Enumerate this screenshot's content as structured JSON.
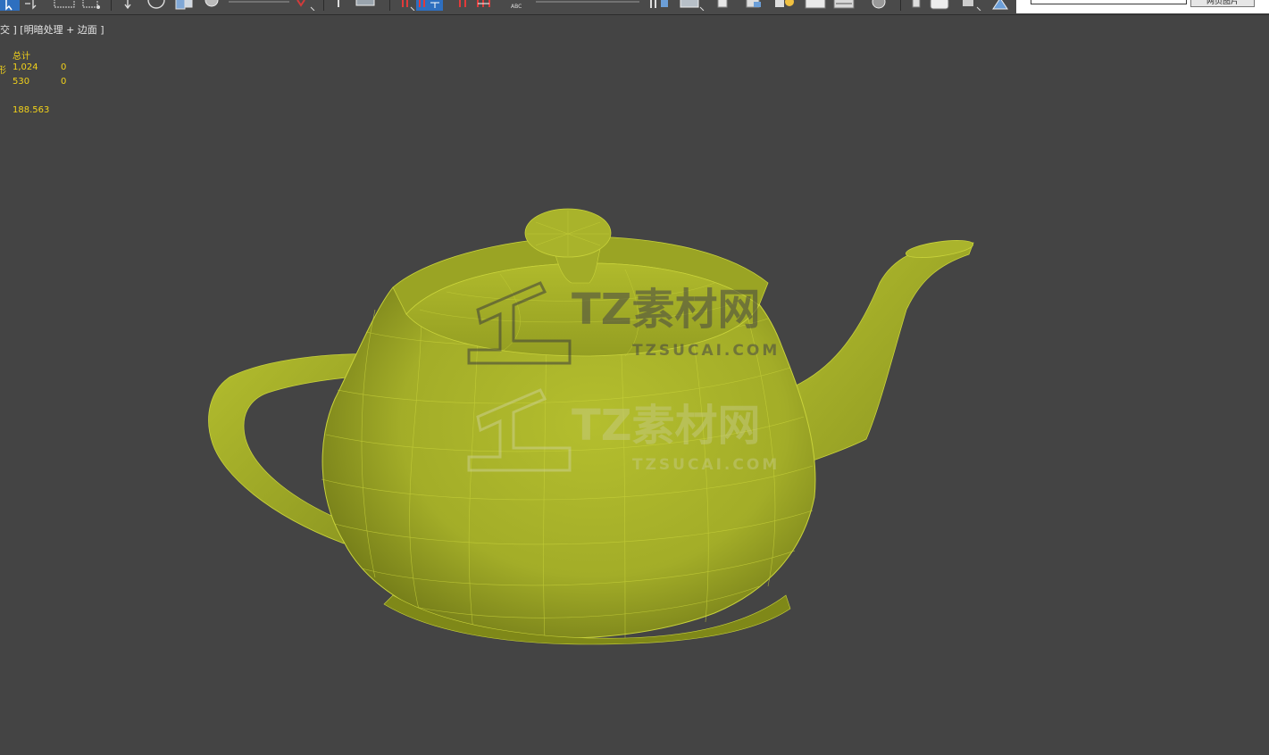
{
  "toolbar": {
    "icons": [
      "select-arrow-icon",
      "select-by-name-icon",
      "rect-region-icon",
      "window-crossing-icon",
      "move-icon",
      "rotate-icon",
      "scale-icon",
      "pivot-icon",
      "keyboard-shortcut-icon",
      "snap-icon",
      "angle-snap-icon",
      "percent-snap-icon",
      "spinner-snap-icon",
      "mirror-icon",
      "align-icon",
      "layer-icon",
      "ribbon-icon",
      "curve-editor-icon",
      "schematic-icon",
      "material-editor-icon",
      "render-setup-icon",
      "render-frame-icon",
      "render-icon"
    ],
    "named_selection_button": "网页图片"
  },
  "viewport": {
    "label": "交 ] [明暗处理 + 边面 ]",
    "stats": {
      "header": "总计",
      "row1_label": "形",
      "row1_total": "1,024",
      "row1_selected": "0",
      "row2_total": "530",
      "row2_selected": "0",
      "fps": "188.563"
    },
    "object": {
      "name": "teapot-mesh",
      "color": "#a4ae2c",
      "wire_color": "#c9d33b"
    },
    "watermark": {
      "brand": "TZ素材网",
      "domain": "TZSUCAI.COM"
    }
  },
  "colors": {
    "viewport_bg": "#444444",
    "stats_text": "#f2d21a",
    "label_text": "#e6e6e6"
  }
}
